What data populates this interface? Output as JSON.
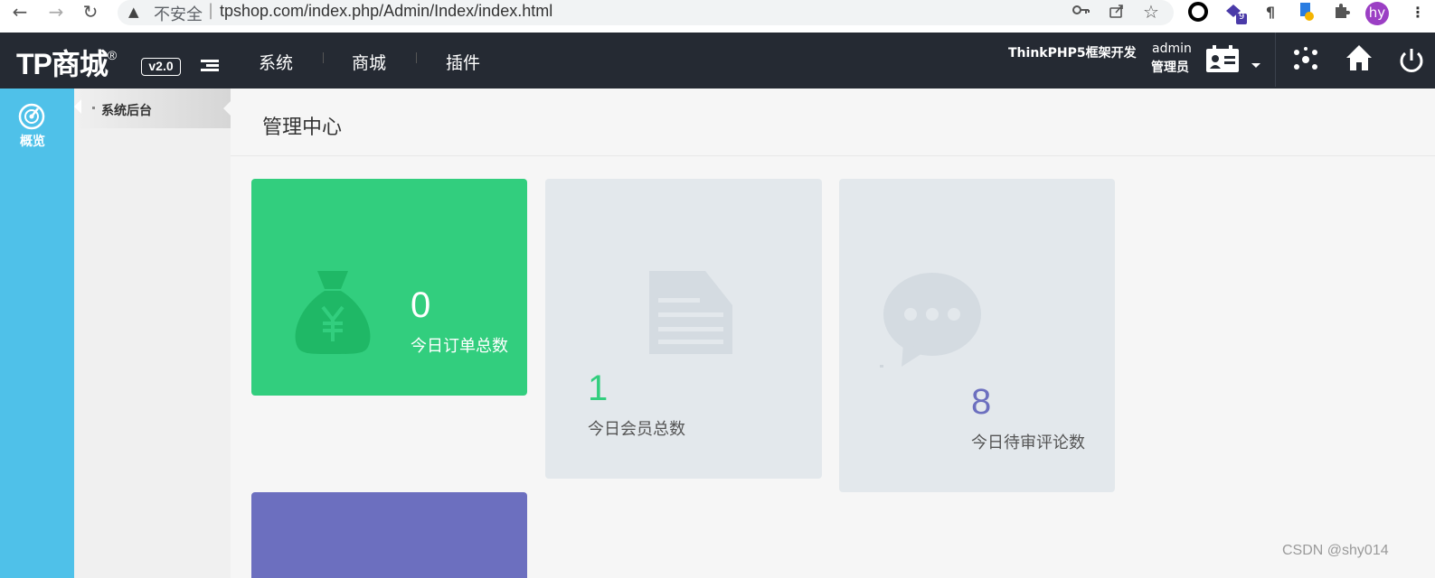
{
  "browser": {
    "insecure_label": "不安全",
    "separator": "|",
    "url": "tpshop.com/index.php/Admin/Index/index.html",
    "ext_badge": "9",
    "profile_initials": "hy"
  },
  "header": {
    "logo_text": "TP商城",
    "logo_reg": "®",
    "version": "v2.0",
    "nav": [
      {
        "label": "系统"
      },
      {
        "label": "商城"
      },
      {
        "label": "插件"
      }
    ],
    "dev_label": "ThinkPHP5框架开发",
    "user_name": "admin",
    "user_role": "管理员"
  },
  "sidebar": {
    "overview_label": "概览"
  },
  "subsidebar": {
    "items": [
      {
        "label": "系统后台"
      }
    ]
  },
  "main": {
    "title": "管理中心",
    "cards": [
      {
        "value": "0",
        "label": "今日订单总数",
        "color": "#32ce7e"
      },
      {
        "value": "1",
        "label": "今日会员总数",
        "color": "#e3e8ec"
      },
      {
        "value": "8",
        "label": "今日待审评论数",
        "color": "#e3e8ec"
      },
      {
        "color": "#6c6fbf"
      }
    ]
  },
  "colors": {
    "header_bg": "#252a33",
    "sidebar_bg": "#4fc1e9",
    "green": "#32ce7e",
    "purple": "#6c6fbf",
    "number_green": "#32ce7e",
    "number_purple": "#6c6fbf"
  },
  "watermark": "CSDN @shy014"
}
